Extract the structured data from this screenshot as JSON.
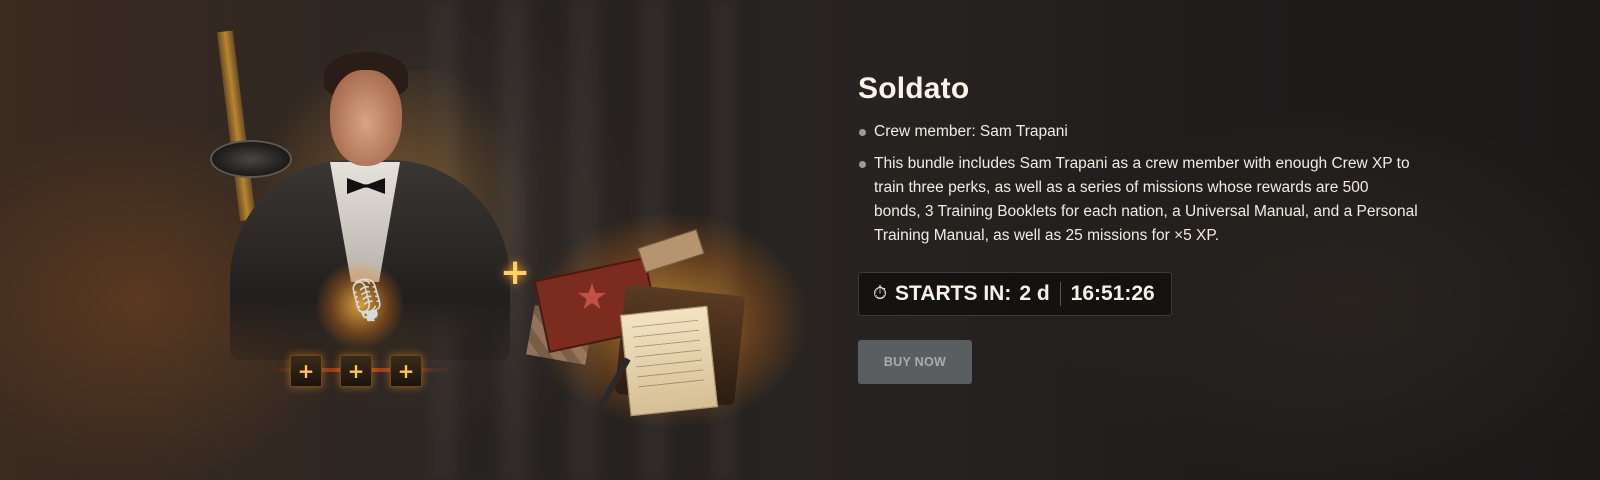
{
  "bundle": {
    "title": "Soldato",
    "bullets": [
      "Crew member: Sam Trapani",
      "This bundle includes Sam Trapani as a crew member with enough Crew XP to train three perks, as well as a series of missions whose rewards are 500 bonds, 3 Training Booklets for each nation, a Universal Manual, and a Personal Training Manual, as well as 25 missions for ×5 XP."
    ]
  },
  "timer": {
    "icon": "stopwatch-icon",
    "label": "STARTS IN:",
    "days": "2 d",
    "time": "16:51:26"
  },
  "actions": {
    "buy_label": "BUY NOW",
    "buy_enabled": false
  },
  "artwork": {
    "perk_slots": [
      "+",
      "+",
      "+"
    ],
    "plus_symbol": "+",
    "icons": [
      "crew-member-portrait",
      "microphone-icon",
      "perk-plus-icon",
      "plus-icon",
      "mission-items-illustration",
      "star-icon"
    ]
  },
  "colors": {
    "background": "#1d1b1a",
    "title": "#fbf3e6",
    "body_text": "#f2ece3",
    "accent_glow": "#ffb23c",
    "button_bg": "#5a5e61",
    "button_text": "#a9acae"
  }
}
